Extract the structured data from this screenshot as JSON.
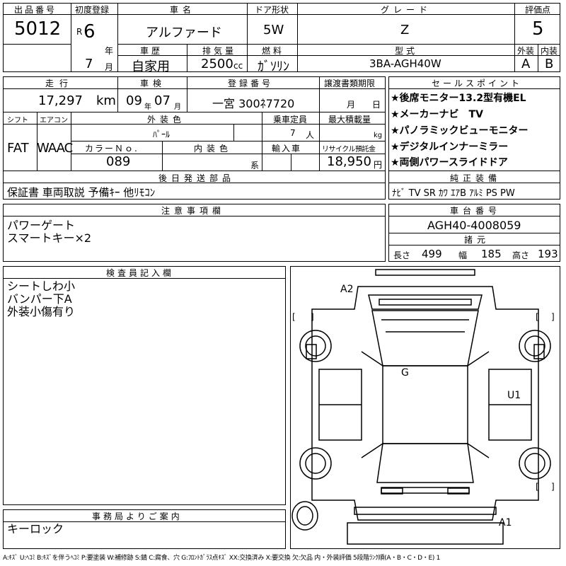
{
  "header": {
    "lot_label": "出品番号",
    "lot": "5012",
    "first_reg_label": "初度登録",
    "era": "R",
    "year": "6",
    "year_unit": "年",
    "month": "7",
    "month_unit": "月",
    "name_label": "車名",
    "name": "アルファード",
    "door_label": "ドア形状",
    "door": "5W",
    "grade_label": "グレード",
    "grade": "Z",
    "score_label": "評価点",
    "score": "5",
    "history_label": "車歴",
    "history": "自家用",
    "displacement_label": "排気量",
    "displacement": "2500",
    "cc": "cc",
    "fuel_label": "燃料",
    "fuel": "ｶﾞｿﾘﾝ",
    "model_label": "型式",
    "model": "3BA-AGH40W",
    "ext_label": "外装",
    "ext": "A",
    "int_label": "内装",
    "int": "B"
  },
  "row2": {
    "mileage_label": "走行",
    "mileage": "17,297",
    "km": "km",
    "inspection_label": "車検",
    "insp_year": "09",
    "insp_year_unit": "年",
    "insp_month": "07",
    "insp_month_unit": "月",
    "regno_label": "登録番号",
    "regno": "一宮 300ﾈ7720",
    "transfer_label": "譲渡書類期限",
    "transfer_month": "月",
    "transfer_day": "日",
    "shift_label": "シフト",
    "shift": "FAT",
    "ac_label": "エアコン",
    "ac": "WAAC",
    "color_label": "外装色",
    "color": "ﾊﾟｰﾙ",
    "capacity_label": "乗車定員",
    "capacity": "7",
    "capacity_unit": "人",
    "load_label": "最大積載量",
    "load_unit": "kg",
    "color_no_label": "カラーＮｏ.",
    "color_no": "089",
    "int_color_label": "内装色",
    "int_color_unit": "系",
    "import_label": "輸入車",
    "recycle_label": "リサイクル預託金",
    "recycle": "18,950",
    "yen": "円"
  },
  "sales_points": {
    "label": "セールスポイント",
    "items": [
      "★後席モニター13.2型有機EL",
      "★メーカーナビ　TV",
      "★パノラミックビューモニター",
      "★デジタルインナーミラー",
      "★両側パワースライドドア"
    ]
  },
  "later_parts": {
    "label": "後日発送部品",
    "text": "保証書 車両取説 予備ｷｰ 他ﾘﾓｺﾝ"
  },
  "equipment": {
    "label": "純正装備",
    "text": "ﾅﾋﾞ TV SR ｶﾜ ｴｱB ｱﾙﾐ PS PW"
  },
  "cautions": {
    "label": "注意事項欄",
    "lines": [
      "パワーゲート",
      "スマートキー×2"
    ]
  },
  "chassis": {
    "label": "車台番号",
    "value": "AGH40-4008059"
  },
  "specs": {
    "label": "諸元",
    "length_label": "長さ",
    "length": "499",
    "width_label": "幅",
    "width": "185",
    "height_label": "高さ",
    "height": "193"
  },
  "inspector": {
    "label": "検査員記入欄",
    "lines": [
      "シートしわ小",
      "バンパー下A",
      "外装小傷有り"
    ]
  },
  "office": {
    "label": "事務局よりご案内",
    "text": "キーロック"
  },
  "diagram": {
    "a2": "A2",
    "g": "G",
    "u1": "U1",
    "a1": "A1",
    "bracket_l": "[",
    "bracket_r": "]"
  },
  "footer": "A:ｷｽﾞ U:ﾍｺﾐ B:ｷｽﾞを伴うﾍｺﾐ P:要塗装 W:補修跡 S:錆 C:腐食、穴 G:ﾌﾛﾝﾄｶﾞﾗｽ点ｷｽﾞ XX:交換済み X:要交換 欠:欠品 内・外装評価 5段階ﾗﾝｸ順(A・B・C・D・E) 1"
}
